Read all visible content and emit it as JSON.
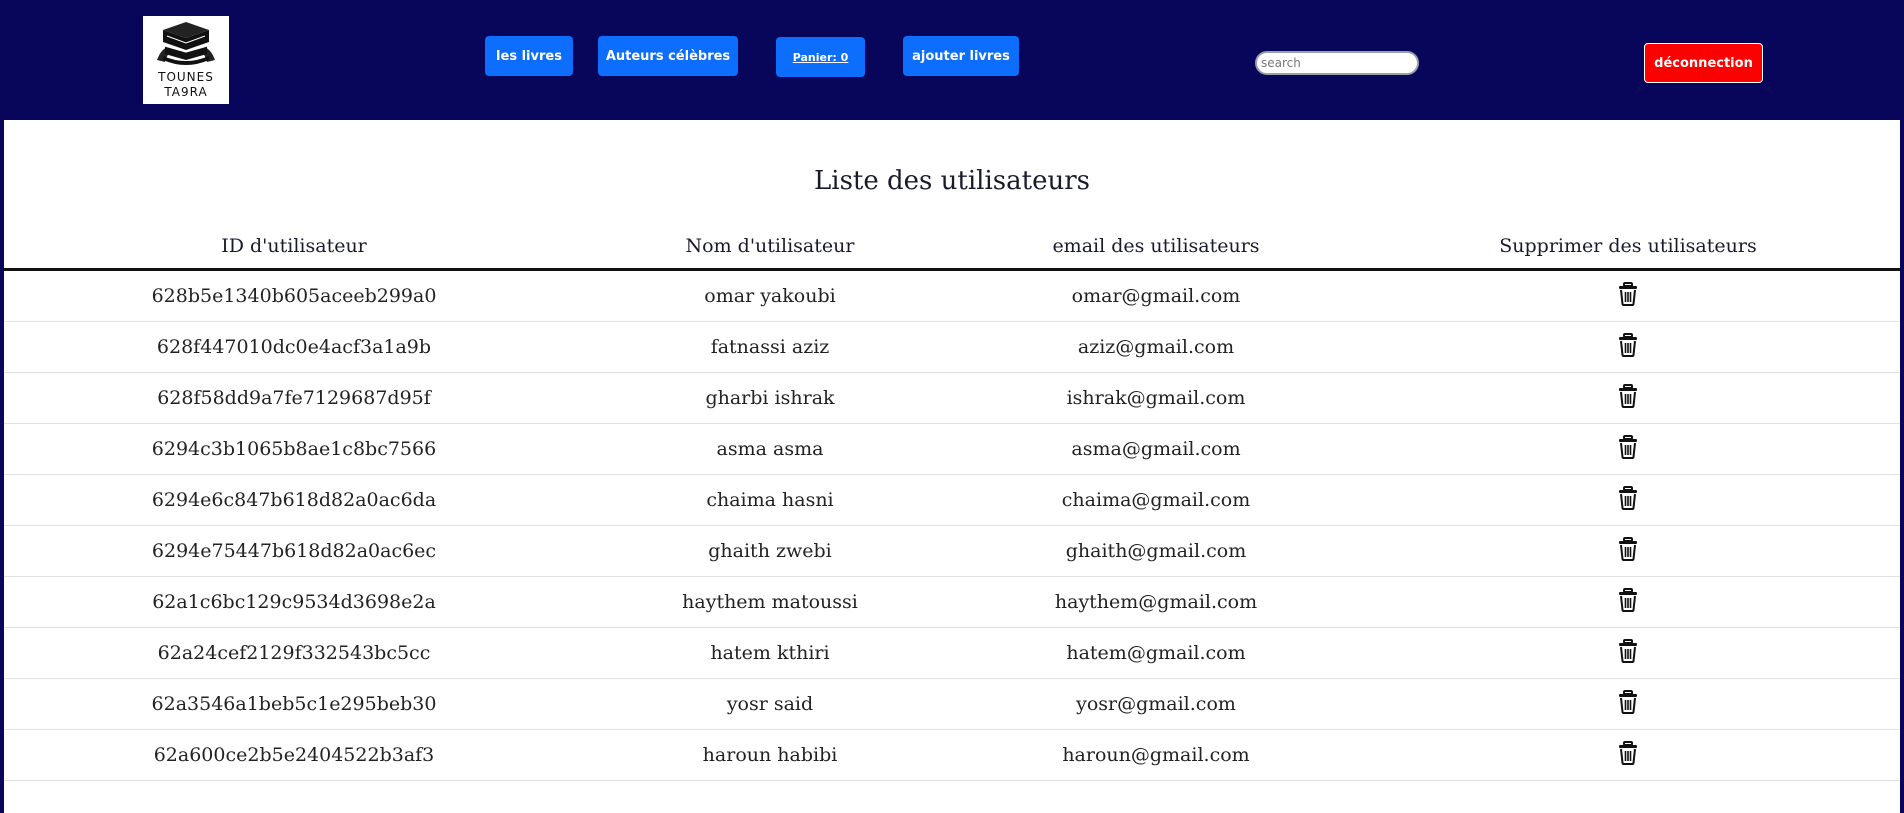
{
  "header": {
    "logo_line1": "TOUNES",
    "logo_line2": "TA9RA",
    "nav": {
      "livres": "les livres",
      "auteurs": "Auteurs célèbres",
      "panier": "Panier: 0",
      "ajouter": "ajouter livres"
    },
    "search_placeholder": "search",
    "logout": "déconnection"
  },
  "main": {
    "title": "Liste des utilisateurs",
    "columns": [
      "ID d'utilisateur",
      "Nom d'utilisateur",
      "email des utilisateurs",
      "Supprimer des utilisateurs"
    ],
    "users": [
      {
        "id": "628b5e1340b605aceeb299a0",
        "name": "omar yakoubi",
        "email": "omar@gmail.com"
      },
      {
        "id": "628f447010dc0e4acf3a1a9b",
        "name": "fatnassi aziz",
        "email": "aziz@gmail.com"
      },
      {
        "id": "628f58dd9a7fe7129687d95f",
        "name": "gharbi ishrak",
        "email": "ishrak@gmail.com"
      },
      {
        "id": "6294c3b1065b8ae1c8bc7566",
        "name": "asma asma",
        "email": "asma@gmail.com"
      },
      {
        "id": "6294e6c847b618d82a0ac6da",
        "name": "chaima hasni",
        "email": "chaima@gmail.com"
      },
      {
        "id": "6294e75447b618d82a0ac6ec",
        "name": "ghaith zwebi",
        "email": "ghaith@gmail.com"
      },
      {
        "id": "62a1c6bc129c9534d3698e2a",
        "name": "haythem matoussi",
        "email": "haythem@gmail.com"
      },
      {
        "id": "62a24cef2129f332543bc5cc",
        "name": "hatem kthiri",
        "email": "hatem@gmail.com"
      },
      {
        "id": "62a3546a1beb5c1e295beb30",
        "name": "yosr said",
        "email": "yosr@gmail.com"
      },
      {
        "id": "62a600ce2b5e2404522b3af3",
        "name": "haroun habibi",
        "email": "haroun@gmail.com"
      }
    ],
    "delete_icon": "trash-icon"
  },
  "colors": {
    "navbar": "#07065a",
    "nav_button": "#0d6efd",
    "logout_button": "#ff0000"
  }
}
